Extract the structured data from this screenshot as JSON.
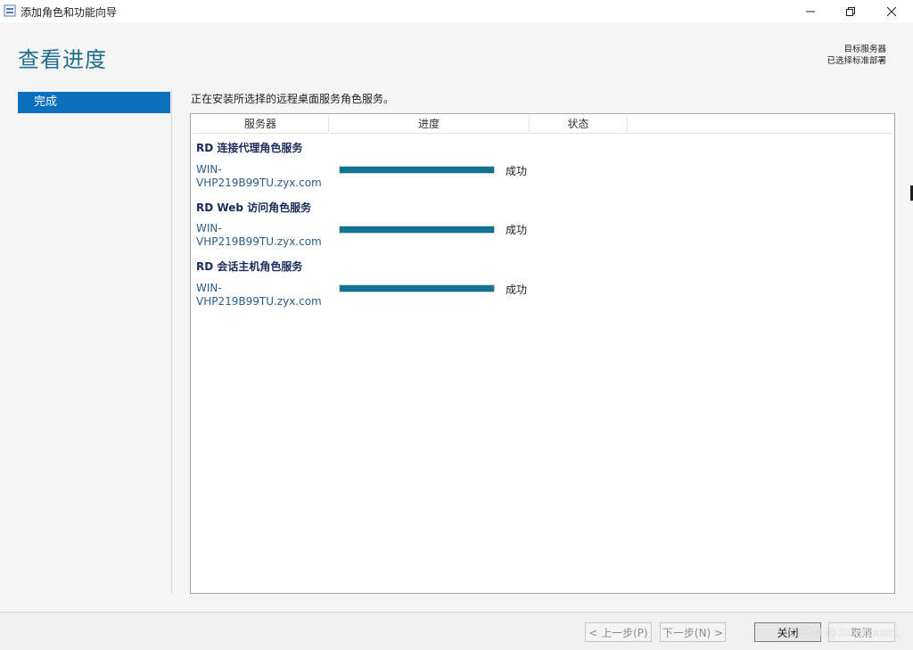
{
  "window": {
    "title": "添加角色和功能向导",
    "app_icon": "server-manager-icon",
    "controls": [
      "minimize-icon",
      "restore-icon",
      "close-icon"
    ]
  },
  "header": {
    "page_title": "查看进度",
    "destination_label": "目标服务器",
    "destination_value": "已选择标准部署"
  },
  "nav": {
    "items": [
      {
        "label": "完成",
        "selected": true
      }
    ]
  },
  "main": {
    "intro": "正在安装所选择的远程桌面服务角色服务。",
    "columns": [
      "服务器",
      "进度",
      "状态"
    ],
    "groups": [
      {
        "title": "RD 连接代理角色服务",
        "rows": [
          {
            "server_line1": "WIN-",
            "server_line2": "VHP219B99TU.zyx.com",
            "progress": 1.0,
            "status": "成功"
          }
        ]
      },
      {
        "title": "RD Web 访问角色服务",
        "rows": [
          {
            "server_line1": "WIN-",
            "server_line2": "VHP219B99TU.zyx.com",
            "progress": 1.0,
            "status": "成功"
          }
        ]
      },
      {
        "title": "RD 会话主机角色服务",
        "rows": [
          {
            "server_line1": "WIN-",
            "server_line2": "VHP219B99TU.zyx.com",
            "progress": 1.0,
            "status": "成功"
          }
        ]
      }
    ]
  },
  "footer": {
    "prev": "< 上一步(P)",
    "next": "下一步(N) >",
    "close": "关闭",
    "cancel": "取消"
  },
  "watermark": "CSDN @Xxxxxxxin.",
  "colors": {
    "accent_title": "#1f6e8c",
    "nav_selected": "#0a6fbd",
    "progress_fill": "#0f7392",
    "group_title": "#1a2c5b"
  }
}
